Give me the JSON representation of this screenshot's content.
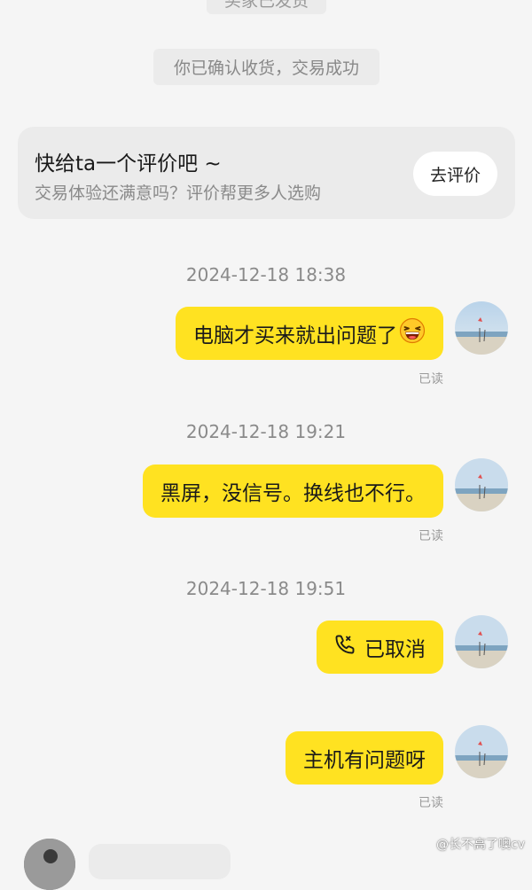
{
  "system_messages": {
    "top_clipped": "买家已发货",
    "confirm": "你已确认收货，交易成功"
  },
  "review_card": {
    "title": "快给ta一个评价吧 ~",
    "subtitle": "交易体验还满意吗？评价帮更多人选购",
    "button": "去评价"
  },
  "messages": [
    {
      "timestamp": "2024-12-18 18:38",
      "text": "电脑才买来就出问题了",
      "emoji": "grinning-squint-emoji",
      "read": "已读"
    },
    {
      "timestamp": "2024-12-18 19:21",
      "text": "黑屏，没信号。换线也不行。",
      "read": "已读"
    },
    {
      "timestamp": "2024-12-18 19:51",
      "text": "已取消",
      "icon": "phone-icon"
    },
    {
      "text": "主机有问题呀",
      "read": "已读"
    }
  ],
  "watermark": "@长不高了噢cv",
  "colors": {
    "background": "#f5f5f5",
    "bubble": "#ffe221",
    "card": "#ebebeb"
  }
}
